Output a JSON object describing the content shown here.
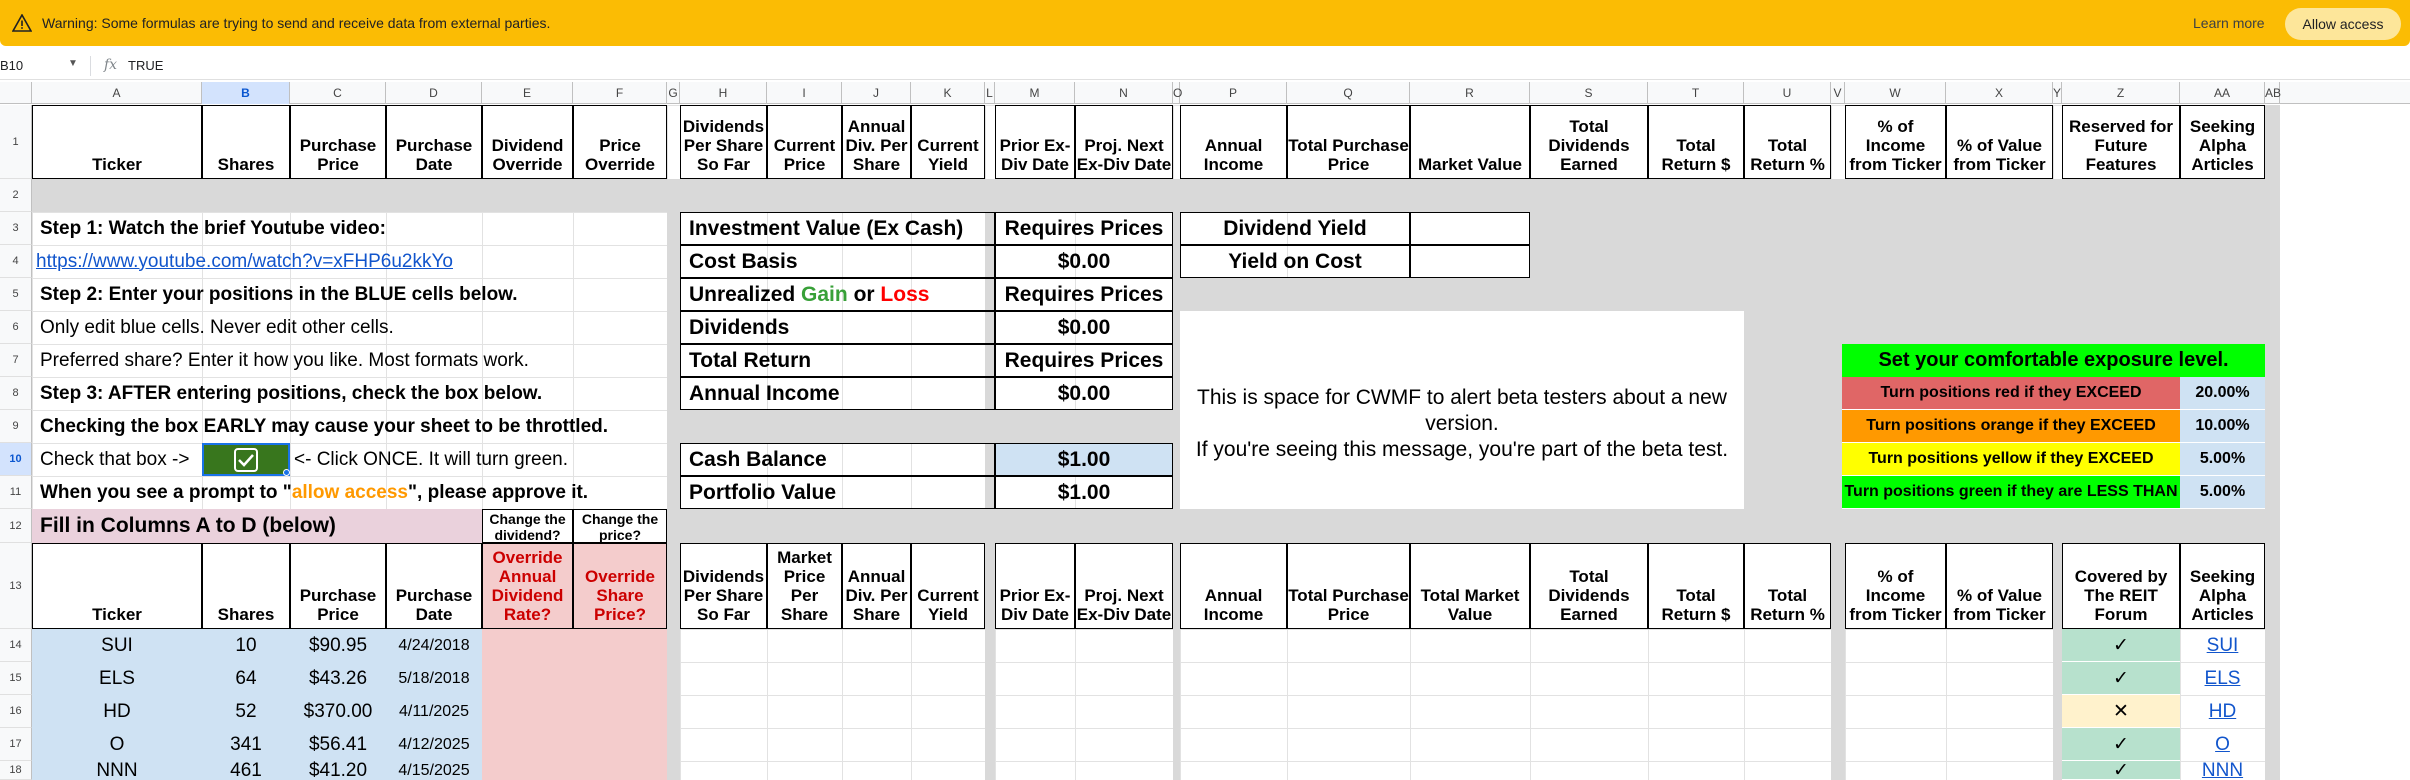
{
  "warning": {
    "text": "Warning: Some formulas are trying to send and receive data from external parties.",
    "learn_more": "Learn more",
    "allow_access": "Allow access"
  },
  "formula_bar": {
    "name_box": "B10",
    "fx": "fx",
    "value": "TRUE"
  },
  "columns": [
    "A",
    "B",
    "C",
    "D",
    "E",
    "F",
    "G",
    "H",
    "I",
    "J",
    "K",
    "L",
    "M",
    "N",
    "O",
    "P",
    "Q",
    "R",
    "S",
    "T",
    "U",
    "V",
    "W",
    "X",
    "Y",
    "Z",
    "AA",
    "AB"
  ],
  "rows": [
    "1",
    "2",
    "3",
    "4",
    "5",
    "6",
    "7",
    "8",
    "9",
    "10",
    "11",
    "12",
    "13",
    "14",
    "15",
    "16",
    "17",
    "18"
  ],
  "header1": {
    "A": "Ticker",
    "B": "Shares",
    "C": "Purchase Price",
    "D": "Purchase Date",
    "E": "Dividend Override",
    "F": "Price Override",
    "H": "Dividends Per Share So Far",
    "I": "Current Price",
    "J": "Annual Div. Per Share",
    "K": "Current Yield",
    "M": "Prior Ex-Div Date",
    "N": "Proj. Next Ex-Div Date",
    "P": "Annual Income",
    "Q": "Total Purchase Price",
    "R": "Market Value",
    "S": "Total Dividends Earned",
    "T": "Total Return $",
    "U": "Total Return %",
    "W": "% of Income from Ticker",
    "X": "% of Value from Ticker",
    "Z": "Reserved for Future Features",
    "AA": "Seeking Alpha Articles"
  },
  "steps": {
    "s1": "Step 1: Watch the brief Youtube video:",
    "link": "https://www.youtube.com/watch?v=xFHP6u2kkYo",
    "s2": "Step 2: Enter your positions in the BLUE cells below.",
    "r6": "Only edit blue cells. Never edit other cells.",
    "r7": "Preferred share? Enter it how you like. Most formats work.",
    "s3": "Step 3: AFTER entering positions, check the box below.",
    "r9": "Checking the box EARLY may cause your sheet to be throttled.",
    "r10a": "Check that box ->",
    "r10b": "<- Click ONCE. It will turn green.",
    "r11a": "When you see a prompt to \"",
    "r11b": "allow access",
    "r11c": "\", please approve it."
  },
  "summary": [
    {
      "label": "Investment Value (Ex Cash)",
      "value": "Requires Prices"
    },
    {
      "label": "Cost Basis",
      "value": "$0.00"
    },
    {
      "label_pre": "Unrealized ",
      "gain": "Gain",
      "mid": " or ",
      "loss": "Loss",
      "value": "Requires Prices"
    },
    {
      "label": "Dividends",
      "value": "$0.00"
    },
    {
      "label": "Total Return",
      "value": "Requires Prices"
    },
    {
      "label": "Annual Income",
      "value": "$0.00"
    }
  ],
  "cash": {
    "cash_label": "Cash Balance",
    "cash_value": "$1.00",
    "portfolio_label": "Portfolio Value",
    "portfolio_value": "$1.00"
  },
  "yield_box": {
    "dy": "Dividend Yield",
    "yoc": "Yield on Cost"
  },
  "beta_msg": {
    "l1": "This is space for CWMF to alert beta testers about a new version.",
    "l2": "If you're seeing this message, you're part of the beta test."
  },
  "exposure": {
    "title": "Set your comfortable exposure level.",
    "rows": [
      {
        "label": "Turn positions red if they EXCEED",
        "value": "20.00%",
        "color": "#e06666"
      },
      {
        "label": "Turn positions orange if they EXCEED",
        "value": "10.00%",
        "color": "#ff9900"
      },
      {
        "label": "Turn positions yellow if they EXCEED",
        "value": "5.00%",
        "color": "#ffff00"
      },
      {
        "label": "Turn positions green if they are LESS THAN",
        "value": "5.00%",
        "color": "#00ff00"
      }
    ]
  },
  "row12": {
    "fill": "Fill in Columns A to D (below)",
    "e": "Change the dividend?",
    "f": "Change the price?"
  },
  "header13": {
    "A": "Ticker",
    "B": "Shares",
    "C": "Purchase Price",
    "D": "Purchase Date",
    "E": "Override Annual Dividend Rate?",
    "F": "Override Share Price?",
    "H": "Dividends Per Share So Far",
    "I": "Market Price Per Share",
    "J": "Annual Div. Per Share",
    "K": "Current Yield",
    "M": "Prior Ex-Div Date",
    "N": "Proj. Next Ex-Div Date",
    "P": "Annual Income",
    "Q": "Total Purchase Price",
    "R": "Total Market Value",
    "S": "Total Dividends Earned",
    "T": "Total Return $",
    "U": "Total Return %",
    "W": "% of Income from Ticker",
    "X": "% of Value from Ticker",
    "Z": "Covered by The REIT Forum",
    "AA": "Seeking Alpha Articles"
  },
  "positions": [
    {
      "ticker": "SUI",
      "shares": "10",
      "price": "$90.95",
      "date": "4/24/2018",
      "reit": "✓",
      "sa": "SUI"
    },
    {
      "ticker": "ELS",
      "shares": "64",
      "price": "$43.26",
      "date": "5/18/2018",
      "reit": "✓",
      "sa": "ELS"
    },
    {
      "ticker": "HD",
      "shares": "52",
      "price": "$370.00",
      "date": "4/11/2025",
      "reit": "✕",
      "sa": "HD"
    },
    {
      "ticker": "O",
      "shares": "341",
      "price": "$56.41",
      "date": "4/12/2025",
      "reit": "✓",
      "sa": "O"
    },
    {
      "ticker": "NNN",
      "shares": "461",
      "price": "$41.20",
      "date": "4/15/2025",
      "reit": "✓",
      "sa": "NNN"
    }
  ],
  "colors": {
    "warning_bg": "#fbbc04",
    "blue_cell": "#cfe2f3",
    "pink_cell": "#f4cccc",
    "checkbox_green": "#38761d",
    "gain": "#38a038",
    "loss": "#ff0000",
    "allow": "#ff9900"
  }
}
